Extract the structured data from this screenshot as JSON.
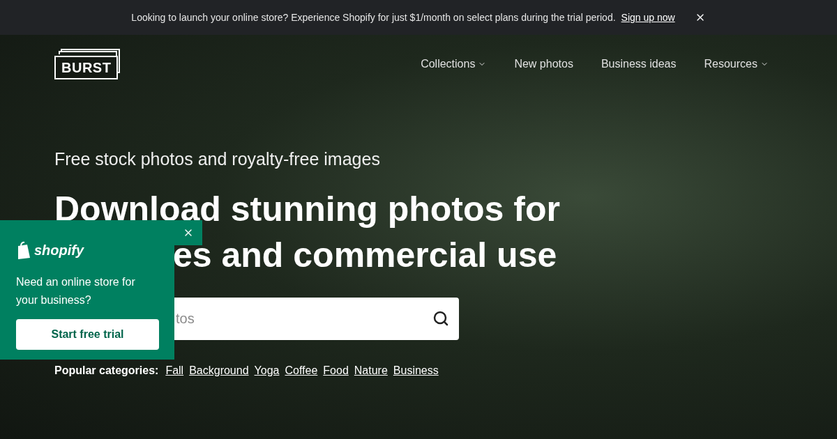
{
  "banner": {
    "text": "Looking to launch your online store? Experience Shopify for just $1/month on select plans during the trial period.",
    "link": "Sign up now"
  },
  "logo": "BURST",
  "nav": [
    {
      "label": "Collections",
      "dropdown": true
    },
    {
      "label": "New photos",
      "dropdown": false
    },
    {
      "label": "Business ideas",
      "dropdown": false
    },
    {
      "label": "Resources",
      "dropdown": true
    }
  ],
  "hero": {
    "subtitle": "Free stock photos and royalty-free images",
    "heading_lines": [
      "Download stunning photos for",
      "es and commercial use"
    ]
  },
  "search": {
    "placeholder": "tos"
  },
  "categories": {
    "label": "Popular categories:",
    "items": [
      "Fall",
      "Background",
      "Yoga",
      "Coffee",
      "Food",
      "Nature",
      "Business"
    ]
  },
  "popup": {
    "brand": "shopify",
    "text": "Need an online store for your business?",
    "button": "Start free trial"
  }
}
